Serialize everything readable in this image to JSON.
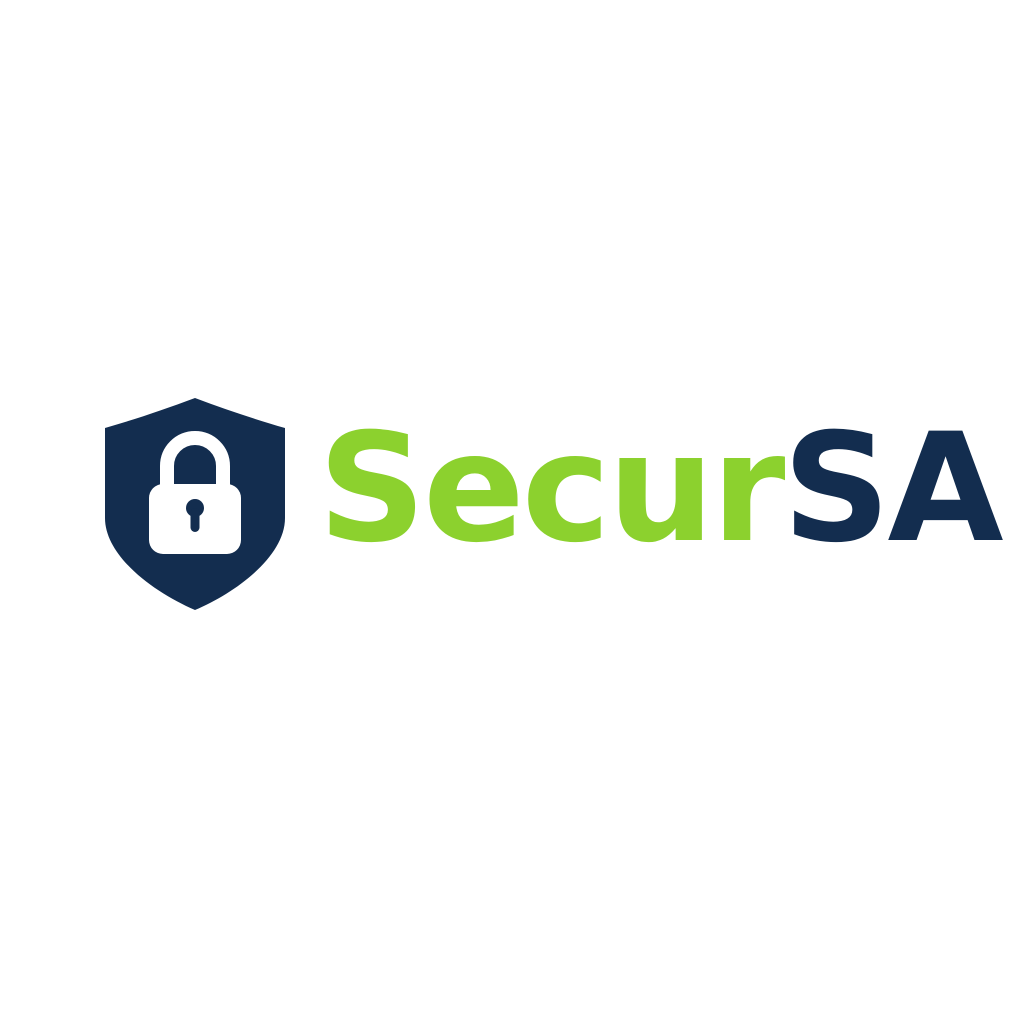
{
  "logo": {
    "wordmark_part1": "Secur",
    "wordmark_part2": "SA",
    "icon": "shield-lock-icon"
  },
  "colors": {
    "brand_green": "#8cd12e",
    "brand_navy": "#132d4f",
    "background": "#ffffff"
  }
}
